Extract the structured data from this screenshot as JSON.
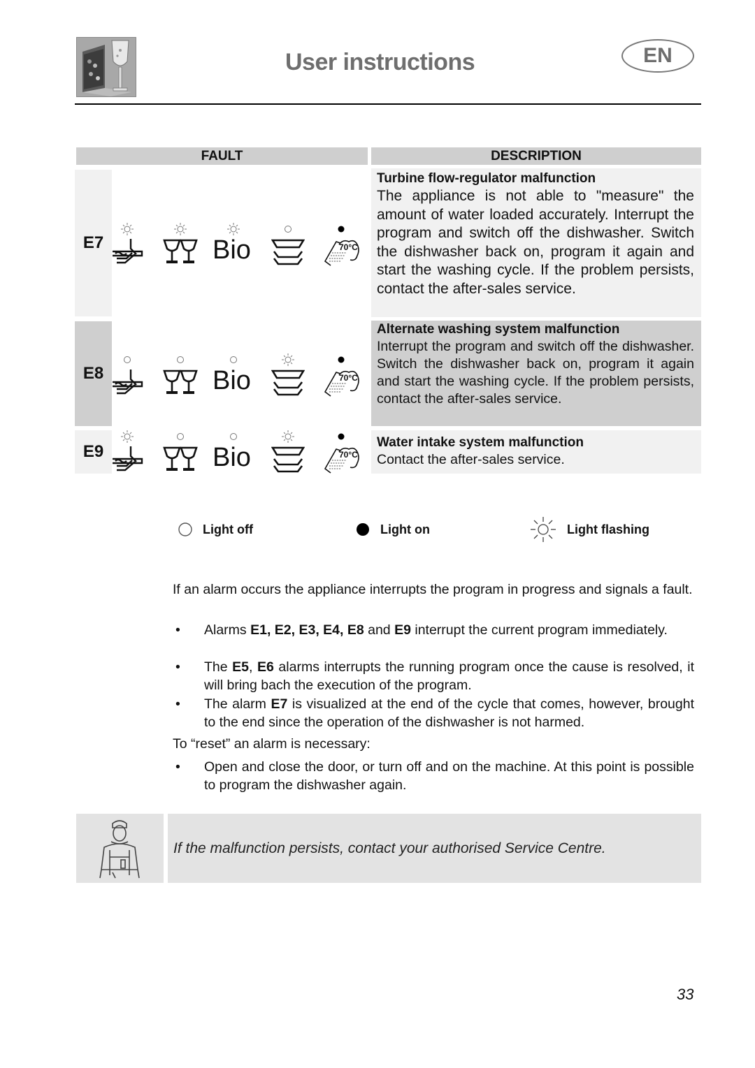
{
  "header": {
    "title": "User instructions",
    "language_badge": "EN",
    "logo_icon": "dishwasher-glass-logo"
  },
  "table": {
    "headers": {
      "fault": "FAULT",
      "description": "DESCRIPTION"
    },
    "panel_symbols": [
      "half-load-symbol",
      "glasses-symbol",
      "Bio",
      "plates-symbol",
      "70°C intensive wash symbol"
    ],
    "bio_label": "Bio",
    "temp_label": "70°C",
    "rows": [
      {
        "code": "E7",
        "indicators": [
          "flashing",
          "flashing",
          "flashing",
          "off",
          "on"
        ],
        "title": "Turbine flow-regulator malfunction",
        "body": "The appliance is not able to \"measure\" the amount of water loaded accurately. Interrupt the program and switch off the dishwasher. Switch the dishwasher back on, program it again and start the washing cycle. If the problem persists, contact the after-sales service."
      },
      {
        "code": "E8",
        "indicators": [
          "off",
          "off",
          "off",
          "flashing",
          "on"
        ],
        "title": "Alternate washing system malfunction",
        "body": "Interrupt the program and switch off the dishwasher. Switch the dishwasher back on, program it again and start the washing cycle. If the problem persists, contact the after-sales service."
      },
      {
        "code": "E9",
        "indicators": [
          "flashing",
          "off",
          "off",
          "flashing",
          "on"
        ],
        "title": "Water intake system malfunction",
        "body": "Contact the after-sales service."
      }
    ]
  },
  "legend": [
    {
      "state": "off",
      "label": "Light off",
      "icon": "circle-outline-icon"
    },
    {
      "state": "on",
      "label": "Light on",
      "icon": "circle-filled-icon"
    },
    {
      "state": "flashing",
      "label": "Light flashing",
      "icon": "sun-rays-icon"
    }
  ],
  "body": {
    "intro": "If an alarm occurs the appliance interrupts the program in progress and signals a fault.",
    "bullets": [
      {
        "parts": [
          "Alarms ",
          "E1, E2, E3, E4, E8",
          " and ",
          "E9",
          " interrupt the current program immediately."
        ]
      },
      {
        "parts": [
          "The ",
          "E5",
          ", ",
          "E6",
          " alarms interrupts the running program once the cause is resolved, it will bring bach the execution of the program."
        ]
      },
      {
        "parts": [
          "The alarm ",
          "E7",
          " is visualized at the end of the cycle that comes, however, brought to the end since the operation of the dishwasher is not harmed."
        ]
      }
    ],
    "reset_intro": "To “reset” an alarm is necessary:",
    "reset_bullets": [
      "Open and close the door, or turn off and on the machine. At this point is possible to program the dishwasher again."
    ],
    "bullet_char": "•"
  },
  "service_note": {
    "icon": "technician-icon",
    "text": "If the malfunction persists, contact your authorised Service Centre."
  },
  "page_number": "33"
}
